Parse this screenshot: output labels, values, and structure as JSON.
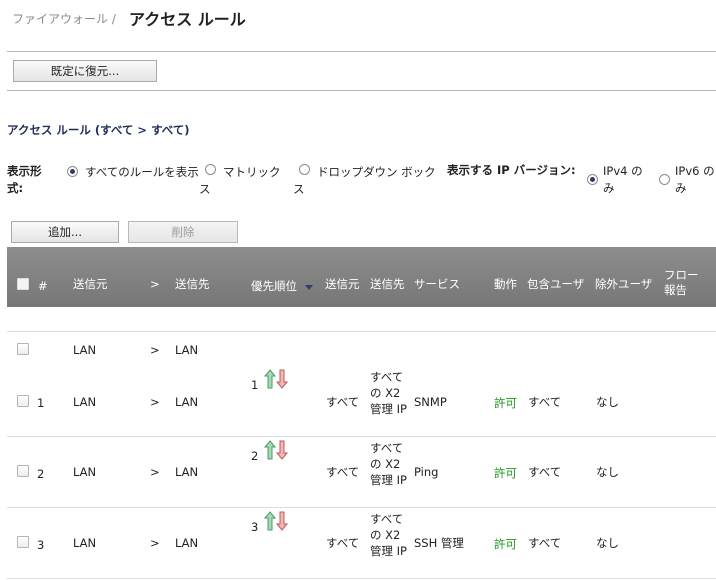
{
  "header": {
    "breadcrumb": "ファイアウォール /",
    "title": "アクセス ルール"
  },
  "toolbar": {
    "restore_label": "既定に復元..."
  },
  "section": {
    "title": "アクセス ルール (すべて > すべて)"
  },
  "view": {
    "label": "表示形式:",
    "options": [
      "すべてのルールを表示",
      "マトリックス",
      "ドロップダウン ボックス"
    ],
    "selected": "すべてのルールを表示"
  },
  "ipver": {
    "label": "表示する IP バージョン:",
    "options": [
      "IPv4 のみ",
      "IPv6 のみ"
    ],
    "selected": "IPv4 のみ"
  },
  "actions": {
    "add_label": "追加...",
    "delete_label": "削除"
  },
  "table": {
    "headers": {
      "num": "#",
      "from": "送信元",
      "arrow": ">",
      "to": "送信先",
      "priority": "優先順位",
      "source": "送信元",
      "destination": "送信先",
      "service": "サービス",
      "action": "動作",
      "users_incl": "包含ユーザ",
      "users_excl": "除外ユーザ",
      "flow": "フロー報告"
    },
    "group": {
      "from": "LAN",
      "arrow": ">",
      "to": "LAN"
    },
    "rows": [
      {
        "num": "1",
        "from": "LAN",
        "arrow": ">",
        "to": "LAN",
        "priority": "1",
        "source": "すべて",
        "destination": "すべての X2 管理 IP",
        "service": "SNMP",
        "action": "許可",
        "users_incl": "すべて",
        "users_excl": "なし"
      },
      {
        "num": "2",
        "from": "LAN",
        "arrow": ">",
        "to": "LAN",
        "priority": "2",
        "source": "すべて",
        "destination": "すべての X2 管理 IP",
        "service": "Ping",
        "action": "許可",
        "users_incl": "すべて",
        "users_excl": "なし"
      },
      {
        "num": "3",
        "from": "LAN",
        "arrow": ">",
        "to": "LAN",
        "priority": "3",
        "source": "すべて",
        "destination": "すべての X2 管理 IP",
        "service": "SSH 管理",
        "action": "許可",
        "users_incl": "すべて",
        "users_excl": "なし"
      }
    ]
  },
  "colors": {
    "accent": "#1f2e55",
    "allow": "#1e9a1e",
    "header_bg": "#808080",
    "up_arrow": "#4f9a6a",
    "down_arrow": "#c05858"
  }
}
